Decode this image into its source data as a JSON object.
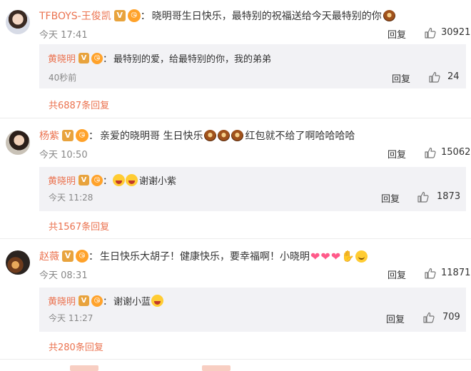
{
  "comments": [
    {
      "user": "TFBOYS-王俊凯",
      "text": "晓明哥生日快乐，最特别的祝福送给今天最特别的你",
      "time": "今天 17:41",
      "reply_label": "回复",
      "likes": "30921",
      "sub_reply": {
        "user": "黄晓明",
        "text": "最特别的爱，给最特别的你，我的弟弟",
        "time": "40秒前",
        "reply_label": "回复",
        "likes": "24"
      },
      "more_replies": "共6887条回复"
    },
    {
      "user": "杨紫",
      "text_a": "亲爱的晓明哥 生日快乐",
      "text_b": "红包就不给了啊哈哈哈哈",
      "time": "今天 10:50",
      "reply_label": "回复",
      "likes": "15062",
      "sub_reply": {
        "user": "黄晓明",
        "text": "谢谢小紫",
        "time": "今天 11:28",
        "reply_label": "回复",
        "likes": "1873"
      },
      "more_replies": "共1567条回复"
    },
    {
      "user": "赵薇",
      "text": "生日快乐大胡子！健康快乐，要幸福啊！小晓明",
      "time": "今天 08:31",
      "reply_label": "回复",
      "likes": "11871",
      "sub_reply": {
        "user": "黄晓明",
        "text": "谢谢小蓝",
        "time": "今天 11:27",
        "reply_label": "回复",
        "likes": "709"
      },
      "more_replies": "共280条回复"
    }
  ],
  "badges": {
    "verified": "V",
    "fan": "😘"
  },
  "colors": {
    "username": "#eb7350",
    "subbox_bg": "#f2f2f5",
    "time": "#888888"
  },
  "icons": {
    "like": "thumbs-up-icon",
    "cake": "cake-emoji",
    "laugh": "laugh-emoji",
    "heart": "heart-emoji",
    "smile": "smile-emoji",
    "hand": "hand-emoji"
  }
}
